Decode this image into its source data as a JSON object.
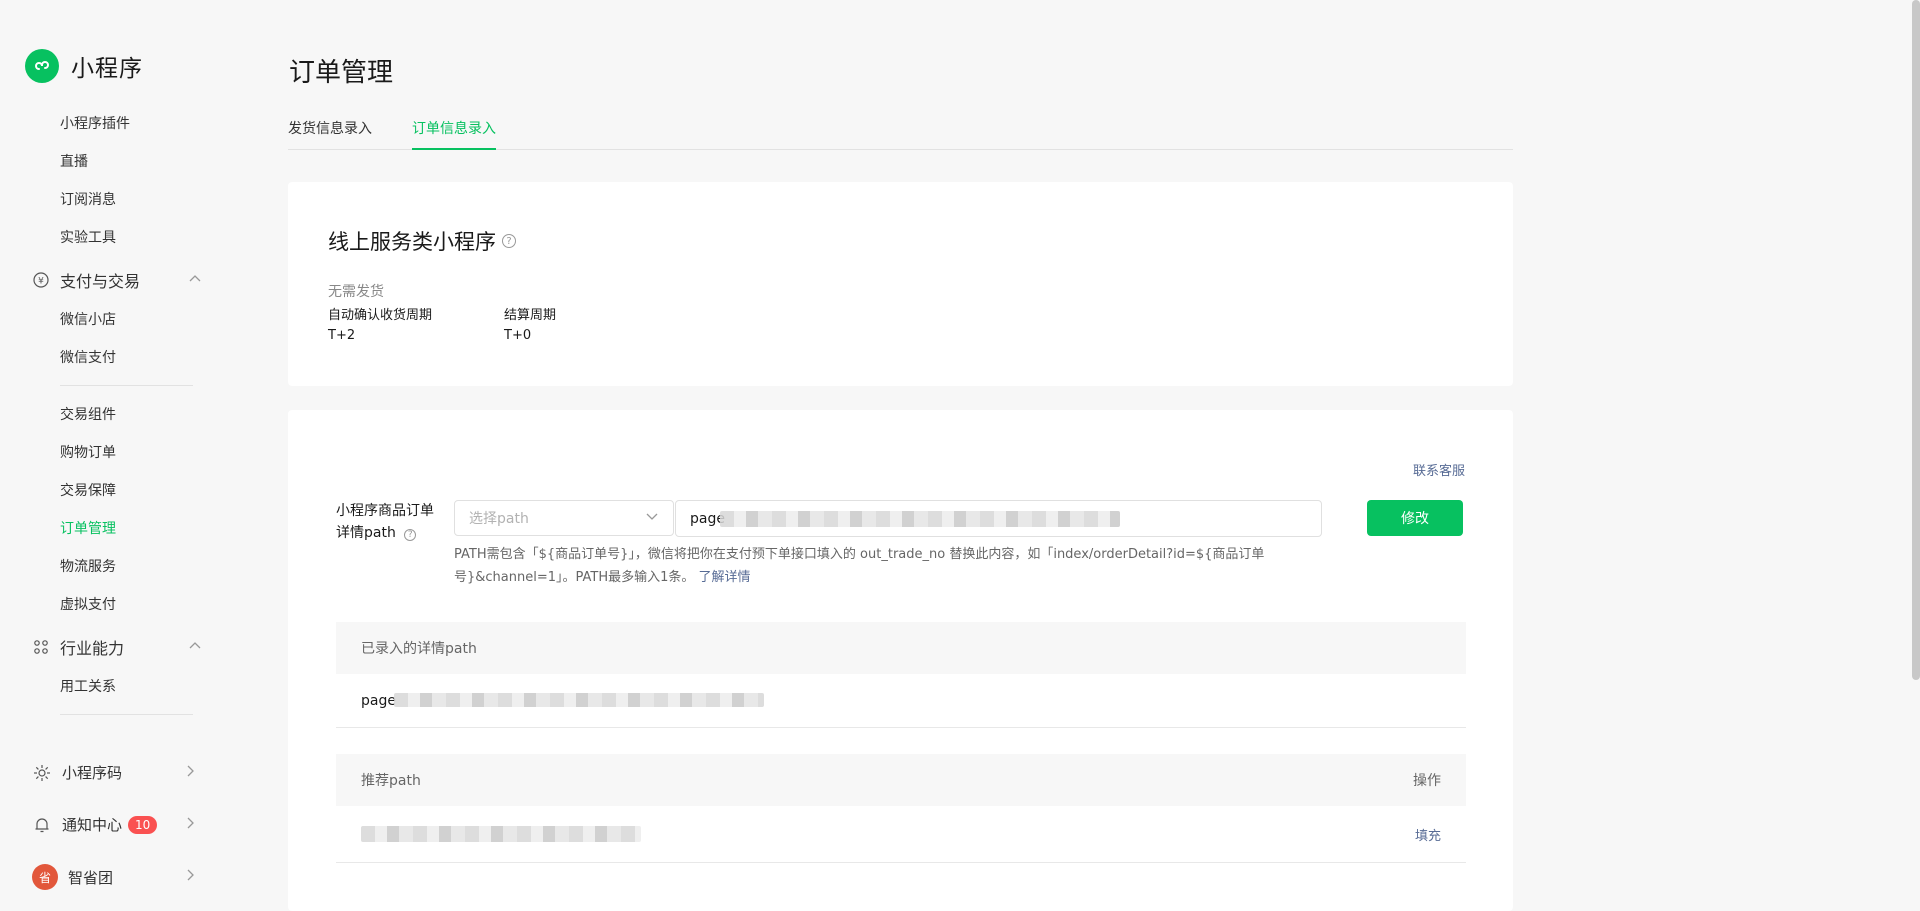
{
  "brand": {
    "name": "小程序"
  },
  "sidebar": {
    "items_top": [
      {
        "label": "小程序插件"
      },
      {
        "label": "直播"
      },
      {
        "label": "订阅消息"
      },
      {
        "label": "实验工具"
      }
    ],
    "group_pay": {
      "label": "支付与交易",
      "icon": "yen-circle-icon"
    },
    "pay_items_a": [
      {
        "label": "微信小店"
      },
      {
        "label": "微信支付"
      }
    ],
    "pay_items_b": [
      {
        "label": "交易组件"
      },
      {
        "label": "购物订单"
      },
      {
        "label": "交易保障"
      },
      {
        "label": "订单管理"
      },
      {
        "label": "物流服务"
      },
      {
        "label": "虚拟支付"
      }
    ],
    "group_industry": {
      "label": "行业能力",
      "icon": "nodes-icon"
    },
    "industry_items": [
      {
        "label": "用工关系"
      }
    ],
    "bottom": [
      {
        "label": "小程序码",
        "icon": "sun-icon"
      },
      {
        "label": "通知中心",
        "icon": "bell-icon",
        "badge": "10"
      },
      {
        "label": "智省团",
        "icon": "avatar-icon",
        "avatar_text": "省"
      }
    ]
  },
  "main": {
    "title": "订单管理",
    "tabs": [
      {
        "label": "发货信息录入",
        "active": false
      },
      {
        "label": "订单信息录入",
        "active": true
      }
    ],
    "service_card": {
      "title": "线上服务类小程序",
      "subtitle": "无需发货",
      "auto_confirm_label": "自动确认收货周期",
      "auto_confirm_value": "T+2",
      "settle_label": "结算周期",
      "settle_value": "T+0"
    },
    "path_card": {
      "contact_link": "联系客服",
      "row_label": "小程序商品订单详情path",
      "select_placeholder": "选择path",
      "input_value": "page",
      "modify_button": "修改",
      "hint_text": "PATH需包含「${商品订单号}」，微信将把你在支付预下单接口填入的 out_trade_no 替换此内容，如「index/orderDetail?id=${商品订单号}&channel=1」。PATH最多输入1条。",
      "learn_more": "了解详情",
      "recorded_header": "已录入的详情path",
      "recorded_value": "page",
      "recommend_header": "推荐path",
      "recommend_op_header": "操作",
      "fill_link": "填充"
    }
  },
  "colors": {
    "accent": "#07c160",
    "link": "#576b95",
    "badge": "#fa5151"
  }
}
